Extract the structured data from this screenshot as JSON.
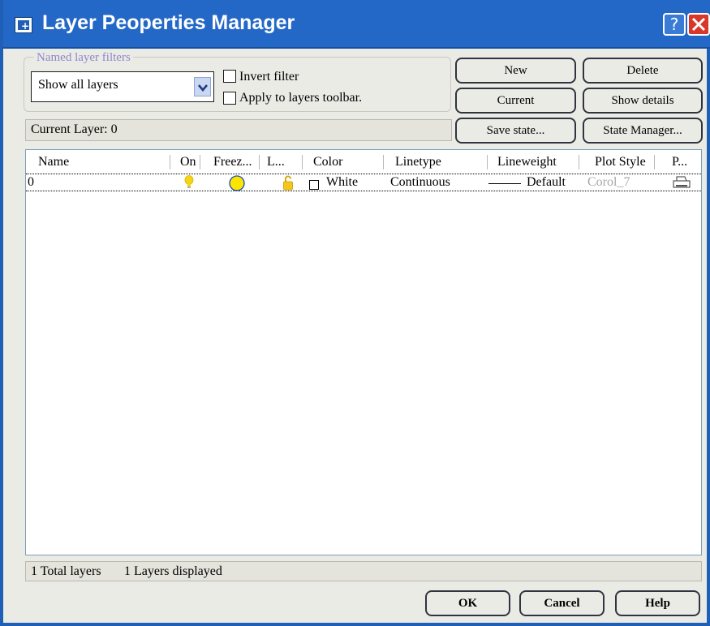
{
  "window": {
    "title": "Layer Peoperties Manager",
    "help_glyph": "?"
  },
  "filters": {
    "legend": "Named layer filters",
    "selected": "Show all layers",
    "invert_label": "Invert filter",
    "apply_label": "Apply to layers toolbar."
  },
  "buttons": {
    "new": "New",
    "delete": "Delete",
    "current": "Current",
    "show_details": "Show details",
    "save_state": "Save state...",
    "state_manager": "State Manager..."
  },
  "current_layer": "Current Layer: 0",
  "table": {
    "columns": [
      "Name",
      "On",
      "Freez...",
      "L...",
      "Color",
      "Linetype",
      "Lineweight",
      "Plot Style",
      "P..."
    ],
    "rows": [
      {
        "name": "0",
        "on_icon": "lightbulb-on-icon",
        "freeze_icon": "sun-thawed-icon",
        "lock_icon": "padlock-unlocked-icon",
        "color_swatch": "#ffffff",
        "color": "White",
        "linetype": "Continuous",
        "lineweight": "Default",
        "plot_style": "Corol_7",
        "plot_icon": "printer-icon"
      }
    ]
  },
  "status": {
    "total": "1 Total layers",
    "displayed": "1 Layers displayed"
  },
  "footer": {
    "ok": "OK",
    "cancel": "Cancel",
    "help": "Help"
  },
  "colors": {
    "title_bar": "#2368c6",
    "close_button": "#d8372a",
    "dialog_bg": "#ebebe6",
    "bulb_yellow": "#f5d515",
    "disabled_text": "#a8a8a8"
  }
}
